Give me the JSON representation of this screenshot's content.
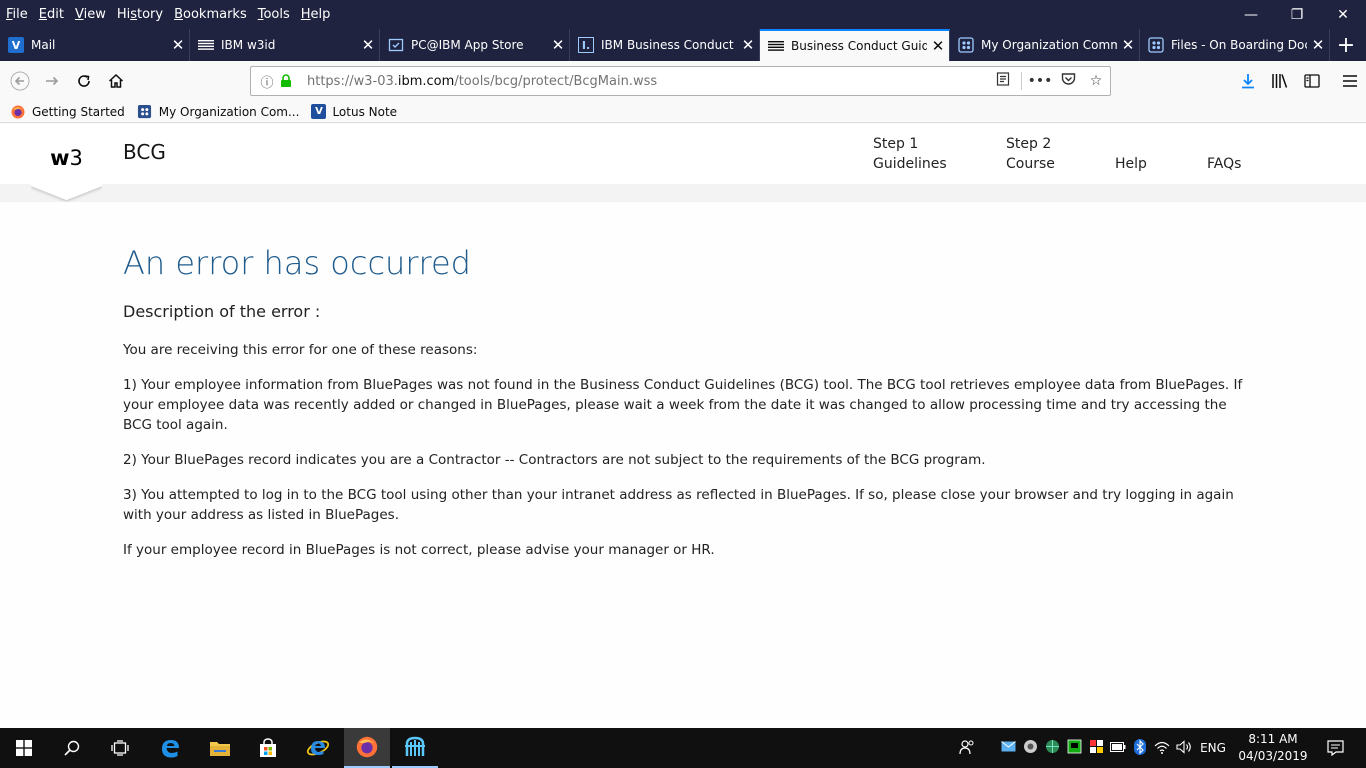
{
  "menubar": {
    "items": [
      "File",
      "Edit",
      "View",
      "History",
      "Bookmarks",
      "Tools",
      "Help"
    ],
    "controls": [
      "—",
      "❐",
      "✕"
    ]
  },
  "tabs": [
    {
      "label": "Mail",
      "icon": "notes-icon",
      "active": false
    },
    {
      "label": "IBM w3id",
      "icon": "ibm-icon",
      "active": false
    },
    {
      "label": "PC@IBM App Store",
      "icon": "appstore-icon",
      "active": false
    },
    {
      "label": "IBM Business Conduct G",
      "icon": "ibm-i-icon",
      "active": false
    },
    {
      "label": "Business Conduct Guide",
      "icon": "ibm-icon",
      "active": true
    },
    {
      "label": "My Organization Comm",
      "icon": "connections-icon",
      "active": false
    },
    {
      "label": "Files - On Boarding Docu",
      "icon": "connections-icon",
      "active": false
    }
  ],
  "newtab_label": "+",
  "urlbar": {
    "prefix": "https://w3-03.",
    "domain": "ibm.com",
    "path": "/tools/bcg/protect/BcgMain.wss",
    "info_icon": "ⓘ"
  },
  "bookmarks": [
    {
      "label": "Getting Started",
      "icon": "firefox-icon"
    },
    {
      "label": "My Organization Com...",
      "icon": "connections-icon"
    },
    {
      "label": "Lotus Note",
      "icon": "notes-icon"
    }
  ],
  "site": {
    "logo_w": "w",
    "logo_3": "3",
    "name": "BCG"
  },
  "topnav": {
    "step1_a": "Step 1",
    "step1_b": "Guidelines",
    "step2_a": "Step 2",
    "step2_b": "Course",
    "help": "Help",
    "faqs": "FAQs"
  },
  "error": {
    "title": "An error has occurred",
    "description": "Description of the error :",
    "intro": "You are receiving this error for one of these reasons:",
    "reason1": "1) Your employee information from BluePages was not found in the Business Conduct Guidelines (BCG) tool. The BCG tool retrieves employee data from BluePages. If your employee data was recently added or changed in BluePages, please wait a week from the date it was changed to allow processing time and try accessing the BCG tool again.",
    "reason2": "2) Your BluePages record indicates you are a Contractor -- Contractors are not subject to the requirements of the BCG program.",
    "reason3": "3) You attempted to log in to the BCG tool using other than your intranet address as reflected in BluePages. If so, please close your browser and try logging in again with your address as listed in BluePages.",
    "footer": "If your employee record in BluePages is not correct, please advise your manager or HR."
  },
  "taskbar": {
    "lang": "ENG",
    "time": "8:11 AM",
    "date": "04/03/2019"
  },
  "colors": {
    "titlebar": "#202340",
    "accent": "#0a84ff",
    "error_title": "#1d5a8b",
    "taskbar": "#101010"
  }
}
